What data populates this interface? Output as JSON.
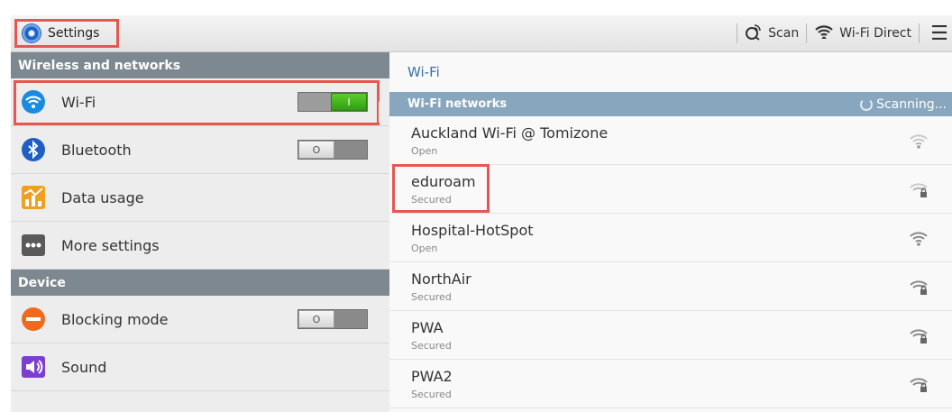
{
  "action_bar": {
    "title": "Settings",
    "app_icon": "settings-gear-icon",
    "actions": [
      {
        "label": "Scan",
        "icon": "scan-icon"
      },
      {
        "label": "Wi-Fi Direct",
        "icon": "wifi-direct-icon"
      }
    ],
    "menu_icon": "overflow-menu-icon"
  },
  "left_pane": {
    "sections": [
      {
        "header": "Wireless and networks",
        "items": [
          {
            "label": "Wi-Fi",
            "icon": "wifi-icon",
            "toggle": "on"
          },
          {
            "label": "Bluetooth",
            "icon": "bluetooth-icon",
            "toggle": "off"
          },
          {
            "label": "Data usage",
            "icon": "data-usage-icon"
          },
          {
            "label": "More settings",
            "icon": "more-settings-icon"
          }
        ]
      },
      {
        "header": "Device",
        "items": [
          {
            "label": "Blocking mode",
            "icon": "blocking-mode-icon",
            "toggle": "off"
          },
          {
            "label": "Sound",
            "icon": "sound-icon"
          }
        ]
      }
    ]
  },
  "right_pane": {
    "title": "Wi-Fi",
    "list_header": "Wi-Fi networks",
    "scanning_text": "Scanning...",
    "networks": [
      {
        "name": "Auckland Wi-Fi @ Tomizone",
        "status": "Open",
        "secured": false
      },
      {
        "name": "eduroam",
        "status": "Secured",
        "secured": true
      },
      {
        "name": "Hospital-HotSpot",
        "status": "Open",
        "secured": false
      },
      {
        "name": "NorthAir",
        "status": "Secured",
        "secured": true
      },
      {
        "name": "PWA",
        "status": "Secured",
        "secured": true
      },
      {
        "name": "PWA2",
        "status": "Secured",
        "secured": true
      }
    ]
  },
  "colors": {
    "highlight": "#e8574f",
    "section_header": "#7d8890",
    "list_header": "#88a6be",
    "title_blue": "#3b6fa5",
    "toggle_on": "#3aa81a"
  }
}
